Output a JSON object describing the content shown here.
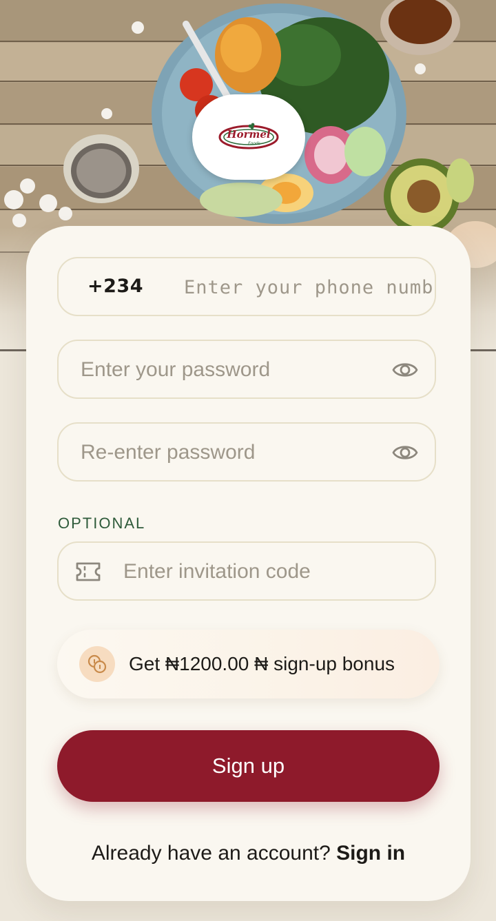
{
  "brand": {
    "logo_text": "Hormel",
    "logo_subtext": "Foods",
    "primary_color": "#8e1a2b",
    "accent_color": "#2e5a3a",
    "card_background": "#faf7f0"
  },
  "form": {
    "phone": {
      "country_code": "+234",
      "placeholder": "Enter your phone number",
      "value": ""
    },
    "password": {
      "placeholder": "Enter your password",
      "value": "",
      "toggle_icon": "eye-icon"
    },
    "confirm_password": {
      "placeholder": "Re-enter password",
      "value": "",
      "toggle_icon": "eye-icon"
    },
    "optional_label": "OPTIONAL",
    "invitation": {
      "placeholder": "Enter invitation code",
      "value": "",
      "icon": "ticket-icon"
    }
  },
  "bonus": {
    "icon": "coins-icon",
    "text": "Get ₦1200.00 ₦ sign-up bonus"
  },
  "actions": {
    "signup_label": "Sign up",
    "signin_prompt": "Already have an account?",
    "signin_label": "Sign in"
  }
}
